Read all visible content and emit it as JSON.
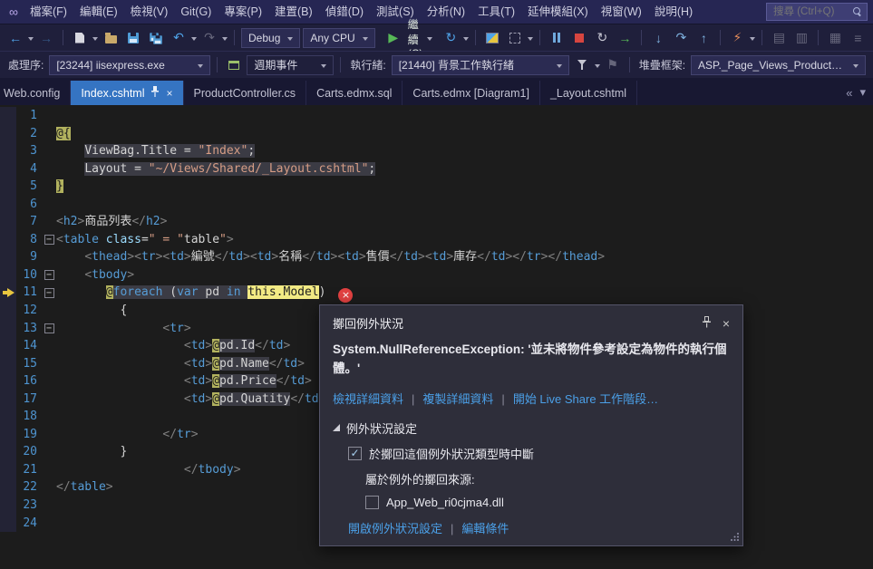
{
  "menubar": {
    "items": [
      "檔案(F)",
      "編輯(E)",
      "檢視(V)",
      "Git(G)",
      "專案(P)",
      "建置(B)",
      "偵錯(D)",
      "測試(S)",
      "分析(N)",
      "工具(T)",
      "延伸模組(X)",
      "視窗(W)",
      "說明(H)"
    ],
    "search_placeholder": "搜尋 (Ctrl+Q)"
  },
  "toolbar": {
    "config": "Debug",
    "platform": "Any CPU",
    "continue_label": "繼續(C)"
  },
  "debug_bar": {
    "process_label": "處理序:",
    "process_value": "[23244] iisexpress.exe",
    "lifecycle_label": "週期事件",
    "thread_label": "執行緒:",
    "thread_value": "[21440] 背景工作執行緒",
    "stack_label": "堆疊框架:",
    "stack_value": "ASP._Page_Views_Product_Index_cshtm"
  },
  "tabs": [
    {
      "label": "Web.config",
      "active": false
    },
    {
      "label": "Index.cshtml",
      "active": true
    },
    {
      "label": "ProductController.cs",
      "active": false
    },
    {
      "label": "Carts.edmx.sql",
      "active": false
    },
    {
      "label": "Carts.edmx [Diagram1]",
      "active": false
    },
    {
      "label": "_Layout.cshtml",
      "active": false
    }
  ],
  "editor": {
    "lines": [
      {
        "n": 1,
        "s": []
      },
      {
        "n": 2,
        "s": [
          {
            "t": "@{",
            "c": "p bgr"
          }
        ]
      },
      {
        "n": 3,
        "s": [
          {
            "t": "    ",
            "c": "p"
          },
          {
            "t": "ViewBag.Title = ",
            "c": "p bgc"
          },
          {
            "t": "\"Index\"",
            "c": "s bgc"
          },
          {
            "t": ";",
            "c": "p bgc"
          }
        ]
      },
      {
        "n": 4,
        "s": [
          {
            "t": "    ",
            "c": "p"
          },
          {
            "t": "Layout = ",
            "c": "p bgc"
          },
          {
            "t": "\"~/Views/Shared/_Layout.cshtml\"",
            "c": "s bgc"
          },
          {
            "t": ";",
            "c": "p bgc"
          }
        ]
      },
      {
        "n": 5,
        "s": [
          {
            "t": "}",
            "c": "p bgr"
          }
        ]
      },
      {
        "n": 6,
        "s": []
      },
      {
        "n": 7,
        "s": [
          {
            "t": "<",
            "c": "d"
          },
          {
            "t": "h2",
            "c": "t"
          },
          {
            "t": ">",
            "c": "d"
          },
          {
            "t": "商品列表",
            "c": "p"
          },
          {
            "t": "</",
            "c": "d"
          },
          {
            "t": "h2",
            "c": "t"
          },
          {
            "t": ">",
            "c": "d"
          }
        ]
      },
      {
        "n": 8,
        "fold": true,
        "s": [
          {
            "t": "<",
            "c": "d"
          },
          {
            "t": "table",
            "c": "t"
          },
          {
            "t": " ",
            "c": "p"
          },
          {
            "t": "class",
            "c": "a"
          },
          {
            "t": "=",
            "c": "p"
          },
          {
            "t": "\" = \"",
            "c": "s"
          },
          {
            "t": "table",
            "c": "p"
          },
          {
            "t": "\"",
            "c": "s"
          },
          {
            "t": ">",
            "c": "d"
          }
        ]
      },
      {
        "n": 9,
        "s": [
          {
            "t": "    ",
            "c": "p"
          },
          {
            "t": "<",
            "c": "d"
          },
          {
            "t": "thead",
            "c": "t"
          },
          {
            "t": "><",
            "c": "d"
          },
          {
            "t": "tr",
            "c": "t"
          },
          {
            "t": "><",
            "c": "d"
          },
          {
            "t": "td",
            "c": "t"
          },
          {
            "t": ">",
            "c": "d"
          },
          {
            "t": "編號",
            "c": "p"
          },
          {
            "t": "</",
            "c": "d"
          },
          {
            "t": "td",
            "c": "t"
          },
          {
            "t": "><",
            "c": "d"
          },
          {
            "t": "td",
            "c": "t"
          },
          {
            "t": ">",
            "c": "d"
          },
          {
            "t": "名稱",
            "c": "p"
          },
          {
            "t": "</",
            "c": "d"
          },
          {
            "t": "td",
            "c": "t"
          },
          {
            "t": "><",
            "c": "d"
          },
          {
            "t": "td",
            "c": "t"
          },
          {
            "t": ">",
            "c": "d"
          },
          {
            "t": "售價",
            "c": "p"
          },
          {
            "t": "</",
            "c": "d"
          },
          {
            "t": "td",
            "c": "t"
          },
          {
            "t": "><",
            "c": "d"
          },
          {
            "t": "td",
            "c": "t"
          },
          {
            "t": ">",
            "c": "d"
          },
          {
            "t": "庫存",
            "c": "p"
          },
          {
            "t": "</",
            "c": "d"
          },
          {
            "t": "td",
            "c": "t"
          },
          {
            "t": "></",
            "c": "d"
          },
          {
            "t": "tr",
            "c": "t"
          },
          {
            "t": "></",
            "c": "d"
          },
          {
            "t": "thead",
            "c": "t"
          },
          {
            "t": ">",
            "c": "d"
          }
        ]
      },
      {
        "n": 10,
        "fold": true,
        "s": [
          {
            "t": "    ",
            "c": "p"
          },
          {
            "t": "<",
            "c": "d"
          },
          {
            "t": "tbody",
            "c": "t"
          },
          {
            "t": ">",
            "c": "d"
          }
        ]
      },
      {
        "n": 11,
        "fold": true,
        "exec": true,
        "err": true,
        "s": [
          {
            "t": "       ",
            "c": "p"
          },
          {
            "t": "@",
            "c": "p bgr"
          },
          {
            "t": "foreach",
            "c": "k bgc"
          },
          {
            "t": " (",
            "c": "p bgc"
          },
          {
            "t": "var",
            "c": "k bgc"
          },
          {
            "t": " pd ",
            "c": "p bgc"
          },
          {
            "t": "in",
            "c": "k bgc"
          },
          {
            "t": " ",
            "c": "p bgc"
          },
          {
            "t": "this.Model",
            "c": "p bgy"
          },
          {
            "t": ")",
            "c": "p"
          }
        ]
      },
      {
        "n": 12,
        "s": [
          {
            "t": "         {",
            "c": "p"
          }
        ]
      },
      {
        "n": 13,
        "fold": true,
        "s": [
          {
            "t": "               ",
            "c": "p"
          },
          {
            "t": "<",
            "c": "d"
          },
          {
            "t": "tr",
            "c": "t"
          },
          {
            "t": ">",
            "c": "d"
          }
        ]
      },
      {
        "n": 14,
        "s": [
          {
            "t": "                  ",
            "c": "p"
          },
          {
            "t": "<",
            "c": "d"
          },
          {
            "t": "td",
            "c": "t"
          },
          {
            "t": ">",
            "c": "d"
          },
          {
            "t": "@",
            "c": "p bgr"
          },
          {
            "t": "pd.Id",
            "c": "p bgc"
          },
          {
            "t": "</",
            "c": "d"
          },
          {
            "t": "td",
            "c": "t"
          },
          {
            "t": ">",
            "c": "d"
          }
        ]
      },
      {
        "n": 15,
        "s": [
          {
            "t": "                  ",
            "c": "p"
          },
          {
            "t": "<",
            "c": "d"
          },
          {
            "t": "td",
            "c": "t"
          },
          {
            "t": ">",
            "c": "d"
          },
          {
            "t": "@",
            "c": "p bgr"
          },
          {
            "t": "pd.Name",
            "c": "p bgc"
          },
          {
            "t": "</",
            "c": "d"
          },
          {
            "t": "td",
            "c": "t"
          },
          {
            "t": ">",
            "c": "d"
          }
        ]
      },
      {
        "n": 16,
        "s": [
          {
            "t": "                  ",
            "c": "p"
          },
          {
            "t": "<",
            "c": "d"
          },
          {
            "t": "td",
            "c": "t"
          },
          {
            "t": ">",
            "c": "d"
          },
          {
            "t": "@",
            "c": "p bgr"
          },
          {
            "t": "pd.Price",
            "c": "p bgc"
          },
          {
            "t": "</",
            "c": "d"
          },
          {
            "t": "td",
            "c": "t"
          },
          {
            "t": ">",
            "c": "d"
          }
        ]
      },
      {
        "n": 17,
        "s": [
          {
            "t": "                  ",
            "c": "p"
          },
          {
            "t": "<",
            "c": "d"
          },
          {
            "t": "td",
            "c": "t"
          },
          {
            "t": ">",
            "c": "d"
          },
          {
            "t": "@",
            "c": "p bgr"
          },
          {
            "t": "pd.Quatity",
            "c": "p bgc"
          },
          {
            "t": "</",
            "c": "d"
          },
          {
            "t": "td",
            "c": "t"
          },
          {
            "t": ">",
            "c": "d"
          }
        ]
      },
      {
        "n": 18,
        "s": []
      },
      {
        "n": 19,
        "s": [
          {
            "t": "               ",
            "c": "p"
          },
          {
            "t": "</",
            "c": "d"
          },
          {
            "t": "tr",
            "c": "t"
          },
          {
            "t": ">",
            "c": "d"
          }
        ]
      },
      {
        "n": 20,
        "s": [
          {
            "t": "         }",
            "c": "p"
          }
        ]
      },
      {
        "n": 21,
        "s": [
          {
            "t": "                  ",
            "c": "p"
          },
          {
            "t": "</",
            "c": "d"
          },
          {
            "t": "tbody",
            "c": "t"
          },
          {
            "t": ">",
            "c": "d"
          }
        ]
      },
      {
        "n": 22,
        "s": [
          {
            "t": "</",
            "c": "d"
          },
          {
            "t": "table",
            "c": "t"
          },
          {
            "t": ">",
            "c": "d"
          }
        ]
      },
      {
        "n": 23,
        "s": []
      },
      {
        "n": 24,
        "s": []
      }
    ]
  },
  "exception_popup": {
    "title": "擲回例外狀況",
    "message": "System.NullReferenceException: '並未將物件參考設定為物件的執行個體。'",
    "links": [
      "檢視詳細資料",
      "複製詳細資料",
      "開始 Live Share 工作階段…"
    ],
    "section_title": "例外狀況設定",
    "break_option": "於擲回這個例外狀況類型時中斷",
    "break_checked": true,
    "source_label": "屬於例外的擲回來源:",
    "source_option": "App_Web_ri0cjma4.dll",
    "source_checked": false,
    "footer_links": [
      "開啟例外狀況設定",
      "編輯條件"
    ]
  }
}
